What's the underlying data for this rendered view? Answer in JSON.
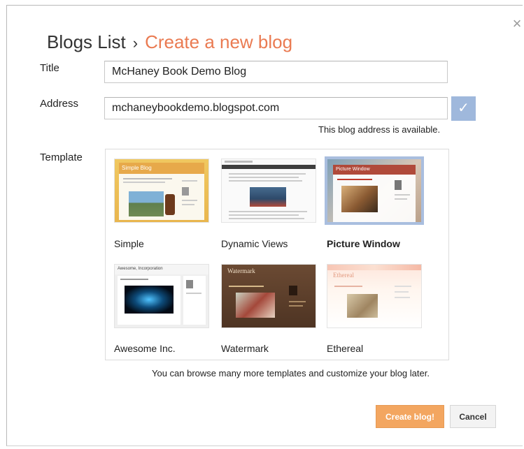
{
  "close": {
    "icon": "close-icon"
  },
  "heading": {
    "breadcrumb": "Blogs List",
    "separator": "›",
    "current": "Create a new blog"
  },
  "form": {
    "title_label": "Title",
    "title_value": "McHaney Book Demo Blog",
    "address_label": "Address",
    "address_value": "mchaneybookdemo.blogspot.com",
    "check_icon": "✓",
    "availability": "This blog address is available.",
    "template_label": "Template"
  },
  "templates": [
    {
      "name": "Simple",
      "selected": false,
      "header_text": "Simple Blog"
    },
    {
      "name": "Dynamic Views",
      "selected": false
    },
    {
      "name": "Picture Window",
      "selected": true,
      "header_text": "Picture Window"
    },
    {
      "name": "Awesome Inc.",
      "selected": false,
      "header_text": "Awesome, Incorporation"
    },
    {
      "name": "Watermark",
      "selected": false,
      "header_text": "Watermark"
    },
    {
      "name": "Ethereal",
      "selected": false,
      "header_text": "Ethereal"
    }
  ],
  "hint": "You can browse many more templates and customize your blog later.",
  "buttons": {
    "create": "Create blog!",
    "cancel": "Cancel"
  },
  "colors": {
    "accent": "#ea7b52",
    "create_button": "#f3a660",
    "selected_outline": "#a9bedf",
    "check_button": "#9fb8dc"
  }
}
